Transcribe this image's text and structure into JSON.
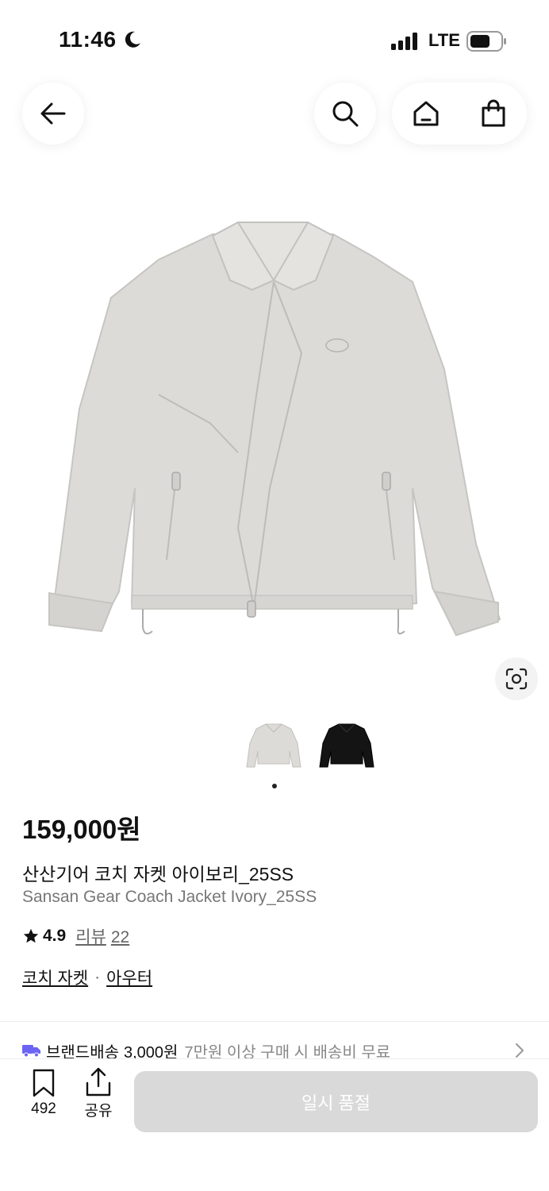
{
  "status": {
    "time": "11:46",
    "network": "LTE"
  },
  "product": {
    "price": "159,000원",
    "name_kr": "산산기어 코치 자켓 아이보리_25SS",
    "name_en": "Sansan Gear Coach Jacket Ivory_25SS",
    "rating": "4.9",
    "review_label": "리뷰",
    "review_count": "22",
    "categories": [
      "코치 자켓",
      "아우터"
    ],
    "category_sep": "·"
  },
  "gallery": {
    "thumbnail_count": 2,
    "active_index": 0
  },
  "shipping": {
    "label": "브랜드배송",
    "fee": "3,000원",
    "note": "7만원 이상 구매 시 배송비 무료"
  },
  "bottom_bar": {
    "bookmark_count": "492",
    "share_label": "공유",
    "cta_label": "일시 품절"
  },
  "colors": {
    "jacket_ivory": "#dcdbd8",
    "jacket_black": "#141414",
    "cta_disabled": "#d9d9d9"
  }
}
